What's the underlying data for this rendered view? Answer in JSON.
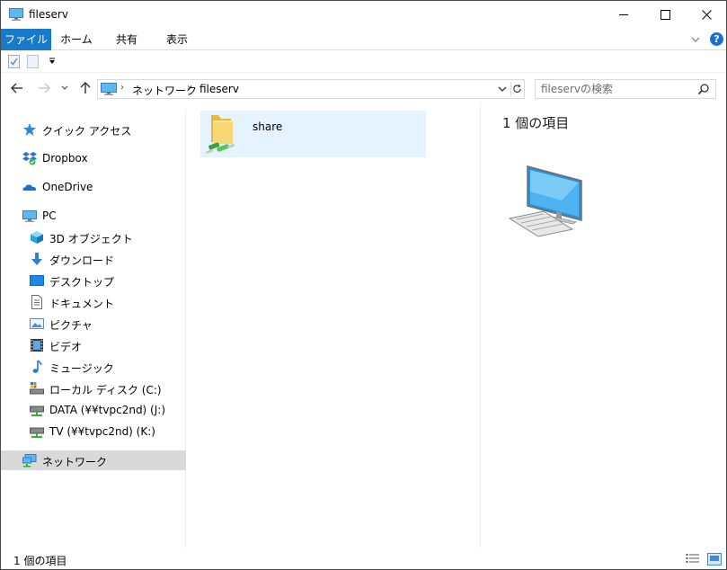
{
  "window": {
    "title": "fileserv"
  },
  "ribbon": {
    "tabs": [
      {
        "label": "ファイル",
        "active": true
      },
      {
        "label": "ホーム"
      },
      {
        "label": "共有"
      },
      {
        "label": "表示"
      }
    ],
    "help": "?"
  },
  "address": {
    "crumbs": [
      "ネットワーク",
      "fileserv"
    ],
    "separator": "›"
  },
  "search": {
    "placeholder": "fileservの検索"
  },
  "sidebar": {
    "items": [
      {
        "label": "クイック アクセス",
        "icon": "star-icon"
      },
      {
        "label": "Dropbox",
        "icon": "dropbox-icon"
      },
      {
        "label": "OneDrive",
        "icon": "cloud-icon"
      },
      {
        "label": "PC",
        "icon": "pc-icon"
      },
      {
        "label": "3D オブジェクト",
        "icon": "cube-icon"
      },
      {
        "label": "ダウンロード",
        "icon": "download-icon"
      },
      {
        "label": "デスクトップ",
        "icon": "desktop-icon"
      },
      {
        "label": "ドキュメント",
        "icon": "document-icon"
      },
      {
        "label": "ピクチャ",
        "icon": "picture-icon"
      },
      {
        "label": "ビデオ",
        "icon": "video-icon"
      },
      {
        "label": "ミュージック",
        "icon": "music-icon"
      },
      {
        "label": "ローカル ディスク (C:)",
        "icon": "local-disk-icon"
      },
      {
        "label": "DATA (¥¥tvpc2nd) (J:)",
        "icon": "network-drive-icon"
      },
      {
        "label": "TV (¥¥tvpc2nd) (K:)",
        "icon": "network-drive-icon"
      },
      {
        "label": "ネットワーク",
        "icon": "network-icon",
        "selected": true
      }
    ]
  },
  "content": {
    "items": [
      {
        "label": "share",
        "icon": "shared-folder-icon"
      }
    ]
  },
  "details": {
    "count": "1 個の項目"
  },
  "status": {
    "count": "1 個の項目"
  },
  "colors": {
    "accent": "#1979ca",
    "selection": "#e5f3ff",
    "nav_selected": "#d9d9d9"
  }
}
